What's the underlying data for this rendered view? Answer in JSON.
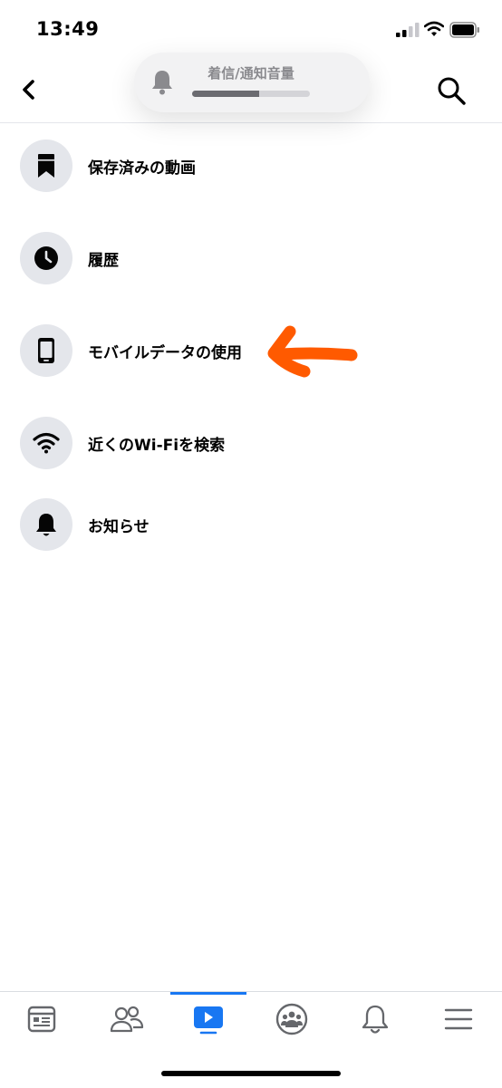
{
  "status_bar": {
    "time": "13:49",
    "signal_icon": "cellular-signal-icon",
    "wifi_icon": "wifi-icon",
    "battery_icon": "battery-icon"
  },
  "header": {
    "back_icon": "chevron-left-icon",
    "search_icon": "search-icon"
  },
  "volume_hud": {
    "label": "着信/通知音量",
    "icon": "bell-icon",
    "level": 0.57
  },
  "menu": {
    "items": [
      {
        "label": "保存済みの動画",
        "icon": "bookmark-icon"
      },
      {
        "label": "履歴",
        "icon": "clock-icon"
      },
      {
        "label": "モバイルデータの使用",
        "icon": "mobile-phone-icon"
      },
      {
        "label": "近くのWi-Fiを検索",
        "icon": "wifi-icon"
      },
      {
        "label": "お知らせ",
        "icon": "bell-icon"
      }
    ]
  },
  "annotation": {
    "icon": "orange-arrow-icon",
    "color": "#ff5a00"
  },
  "tab_bar": {
    "active_index": 2,
    "accent": "#1877f2",
    "tabs": [
      {
        "icon": "news-feed-icon"
      },
      {
        "icon": "friends-icon"
      },
      {
        "icon": "watch-video-icon"
      },
      {
        "icon": "groups-icon"
      },
      {
        "icon": "notifications-bell-icon"
      },
      {
        "icon": "menu-hamburger-icon"
      }
    ]
  }
}
